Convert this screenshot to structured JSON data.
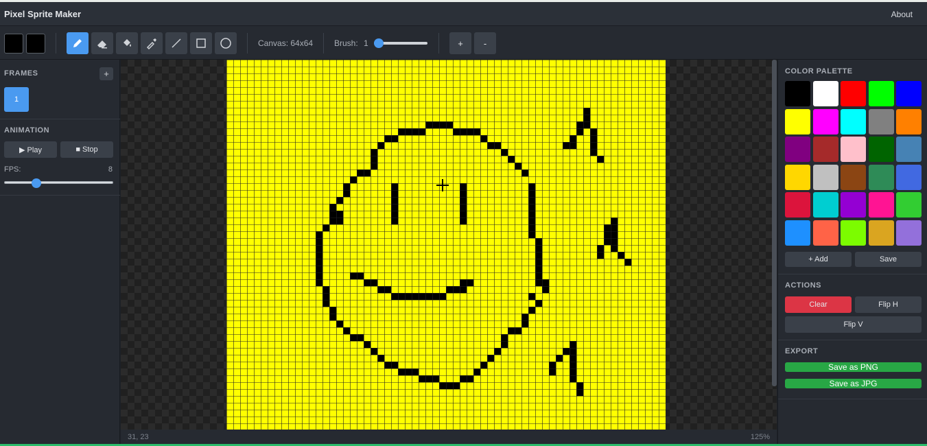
{
  "app": {
    "title": "Pixel Sprite Maker",
    "about_label": "About"
  },
  "toolbar": {
    "primary_color": "#000000",
    "secondary_color": "#000000",
    "tools": [
      {
        "name": "pencil-icon",
        "active": true
      },
      {
        "name": "eraser-icon",
        "active": false
      },
      {
        "name": "fill-bucket-icon",
        "active": false
      },
      {
        "name": "eyedropper-icon",
        "active": false
      },
      {
        "name": "line-icon",
        "active": false
      },
      {
        "name": "rectangle-icon",
        "active": false
      },
      {
        "name": "circle-icon",
        "active": false
      }
    ],
    "canvas_label": "Canvas: 64x64",
    "brush_label": "Brush:",
    "brush_value": "1",
    "brush_slider_fraction": 0.0,
    "zoom_in_label": "+",
    "zoom_out_label": "-"
  },
  "frames": {
    "title": "FRAMES",
    "add_label": "+",
    "items": [
      "1"
    ]
  },
  "animation": {
    "title": "ANIMATION",
    "play_label": "▶ Play",
    "stop_label": "■ Stop",
    "fps_label": "FPS:",
    "fps_value": "8",
    "fps_slider_fraction": 0.27
  },
  "canvas": {
    "background_color": "#ffff00",
    "grid_color": "#222222",
    "pixel_color": "#000000",
    "cursor": "crosshair"
  },
  "status": {
    "coords": "31, 23",
    "zoom": "125%"
  },
  "palette": {
    "title": "COLOR PALETTE",
    "colors": [
      "#000000",
      "#ffffff",
      "#ff0000",
      "#00ff00",
      "#0000ff",
      "#ffff00",
      "#ff00ff",
      "#00ffff",
      "#808080",
      "#ff8000",
      "#800080",
      "#a52a2a",
      "#ffc0cb",
      "#006400",
      "#4682b4",
      "#ffd700",
      "#c0c0c0",
      "#8b4513",
      "#2e8b57",
      "#4169e1",
      "#dc143c",
      "#00ced1",
      "#9400d3",
      "#ff1493",
      "#32cd32",
      "#1e90ff",
      "#ff6347",
      "#7cfc00",
      "#daa520",
      "#9370db"
    ],
    "add_label": "+ Add",
    "save_label": "Save"
  },
  "actions": {
    "title": "ACTIONS",
    "clear_label": "Clear",
    "flip_h_label": "Flip H",
    "flip_v_label": "Flip V",
    "clear_color": "#dc3545"
  },
  "export": {
    "title": "EXPORT",
    "png_label": "Save as PNG",
    "jpg_label": "Save as JPG",
    "button_color": "#28a745"
  }
}
